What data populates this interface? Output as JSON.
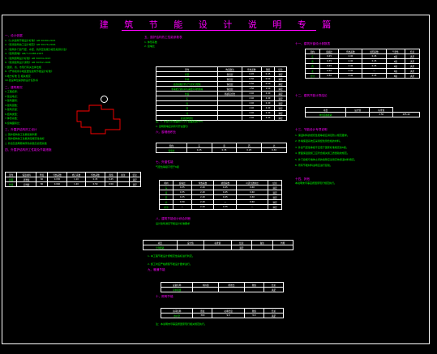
{
  "document": {
    "title": "建 筑 节 能 设 计 说 明 专 篇"
  },
  "left": {
    "sec1_heading": "一、设计依据",
    "sec1_items": [
      "1.《公共建筑节能设计标准》GB 50189-2015",
      "2.《民用建筑热工设计规范》GB 50176-2016",
      "3.《建筑外门窗气密、水密、抗风压性能分级及检测方法》",
      "4.《建筑幕墙》GB/T 21086-2007",
      "5.《建筑照明设计标准》GB 50034-2013",
      "6.《民用建筑设计通则》GB 50352-2005",
      "7.国家、省、市现行有关法律法规",
      "8.《严寒和寒冷地区居住建筑节能设计标准》",
      "9.地方标准 及 相关规定",
      "10.建设单位提供的设计任务书"
    ],
    "sec2_heading": "二、建筑概况",
    "sec2_items": [
      "1.工程名称：",
      "2.建设地点：",
      "3.建筑面积：",
      "4.建筑层数：",
      "5.建筑高度：",
      "6.结构类型：",
      "7.体形系数：",
      "8.窗墙面积比："
    ],
    "sec3_heading": "三、外围护结构热工设计",
    "sec3_items": [
      "□ 围护结构热工性能权衡判断",
      "□ 围护结构热工性能满足规定性指标",
      "□ 外窗及透明幕墙传热系数及遮阳系数"
    ],
    "sec4_heading": "四、外围护结构热工性能及节能措施",
    "table_headers": [
      "部位",
      "保温材料",
      "厚度",
      "导热系数",
      "修正系数",
      "传热系数",
      "限值",
      "备注",
      "结论"
    ],
    "table_rows": [
      [
        "屋面",
        "挤塑板",
        "60",
        "0.030",
        "1.10",
        "0.45",
        "0.45",
        "",
        "满足"
      ],
      [
        "外墙",
        "岩棉板",
        "80",
        "0.040",
        "1.20",
        "0.50",
        "0.50",
        "",
        "满足"
      ]
    ]
  },
  "middle": {
    "sec5_heading": "五、围护结构热工性能参数表",
    "sec5_line1": "1. 体形系数",
    "sec5_line2": "2. 窗墙比",
    "table1_headers": [
      "部位",
      "构造做法",
      "传热系数",
      "限值",
      "结论"
    ],
    "table1_rows": [
      [
        "屋面",
        "保温层",
        "0.45",
        "0.45",
        "满足"
      ],
      [
        "外墙",
        "保温层",
        "0.50",
        "0.50",
        "满足"
      ],
      [
        "底面接触室外空气的架空楼板",
        "保温层",
        "0.50",
        "0.50",
        "满足"
      ],
      [
        "非采暖空调房间与采暖房间的隔墙",
        "保温层",
        "1.50",
        "1.50",
        "满足"
      ],
      [
        "外窗",
        "断桥铝合金",
        "2.40",
        "2.40",
        "满足"
      ],
      [
        "东",
        "",
        "2.40",
        "2.40",
        "满足"
      ],
      [
        "南",
        "",
        "2.40",
        "2.40",
        "满足"
      ],
      [
        "西",
        "",
        "2.40",
        "2.40",
        "满足"
      ],
      [
        "北",
        "",
        "2.40",
        "2.40",
        "满足"
      ],
      [
        "屋顶透明部分",
        "",
        "2.40",
        "2.40",
        "满足"
      ]
    ],
    "note1": "注：1. 外窗可开启面积不小于窗面积的30%",
    "note2": "2. 透明幕墙应具有可开启部分",
    "sec6_heading": "六、窗墙面积比",
    "table2_headers": [
      "朝向",
      "东",
      "南",
      "西",
      "北"
    ],
    "table2_rows": [
      [
        "窗墙比",
        "0.25",
        "0.35",
        "0.25",
        "0.30"
      ]
    ],
    "sec7_heading": "七、外窗性能",
    "sec7_line": "气密性等级不低于6级",
    "table3_headers": [
      "朝向",
      "窗墙比",
      "传热系数",
      "遮阳系数",
      "可见光透射比",
      "结论"
    ],
    "table3_rows": [
      [
        "东",
        "0.25",
        "2.40",
        "0.45",
        "0.60",
        "满足"
      ],
      [
        "南",
        "0.35",
        "2.40",
        "0.45",
        "0.60",
        "满足"
      ],
      [
        "西",
        "0.25",
        "2.40",
        "0.45",
        "0.60",
        "满足"
      ],
      [
        "北",
        "0.30",
        "2.40",
        "—",
        "0.60",
        "满足"
      ],
      [
        "屋顶",
        "—",
        "2.40",
        "0.35",
        "—",
        "满足"
      ]
    ],
    "sec8_heading": "八、建筑节能设计综合判断",
    "sec8_line": "设计建筑满足节能设计标准要求",
    "table4_headers": [
      "项目",
      "设计值",
      "标准值",
      "结论",
      "备注",
      "判断"
    ],
    "table4_rows": [
      [
        "全年能耗",
        "",
        "",
        "满足",
        "",
        ""
      ]
    ],
    "sec9_line1": "1. 本工程节能设计按规定性指标进行判定。",
    "sec9_line2": "2. 施工时应严格按照节能设计要求进行。",
    "sec10_heading": "九、暖通节能",
    "table5_headers": [
      "设备名称",
      "制冷量",
      "能效比",
      "限值",
      "结论"
    ],
    "table5_rows": [
      [
        "冷水机组",
        "",
        "",
        "",
        "满足"
      ]
    ],
    "sec11_heading": "十、照明节能",
    "table6_headers": [
      "房间名称",
      "照度",
      "功率密度",
      "限值",
      "结论"
    ],
    "table6_rows": [
      [
        "办公室",
        "300",
        "9.0",
        "9.0",
        "满足"
      ]
    ],
    "footer_line": "注：本说明未尽事宜按国家现行相关规范执行。"
  },
  "right": {
    "sec1_heading": "十一、建筑外窗设计参数表",
    "table1_headers": [
      "朝向",
      "窗墙比",
      "传热系数",
      "遮阳系数",
      "气密性",
      "结论"
    ],
    "table1_rows": [
      [
        "东",
        "0.25",
        "2.40",
        "0.45",
        "6级",
        "满足"
      ],
      [
        "南",
        "0.35",
        "2.40",
        "0.45",
        "6级",
        "满足"
      ],
      [
        "西",
        "0.25",
        "2.40",
        "0.45",
        "6级",
        "满足"
      ],
      [
        "北",
        "0.30",
        "2.40",
        "—",
        "6级",
        "满足"
      ],
      [
        "合计",
        "0.30",
        "2.40",
        "0.45",
        "6级",
        "满足"
      ]
    ],
    "sec2_heading": "十二、建筑节能计算结论",
    "table2_headers": [
      "项目",
      "设计值",
      "标准值"
    ],
    "table2_rows": [
      [
        "单位面积能耗",
        "",
        "2.50",
        "205.42"
      ]
    ],
    "sec3_heading": "十三、节能设计专项说明",
    "sec3_items": [
      "1. 保温材料的燃烧性能等级应满足防火规范要求。",
      "2. 外墙保温系统应采用经检测合格的材料。",
      "3. 外窗气密性等级不应低于国家标准规定的6级。",
      "4. 屋面保温层施工应符合相关施工质量验收规范。",
      "5. 外门窗框与墙体之间的缝隙应采用高效保温材料填实。",
      "6. 所有节能材料进场应进行复验。"
    ],
    "sec4_heading": "十四、其他",
    "sec4_line": "本说明未尽事宜按国家现行规范执行。"
  }
}
